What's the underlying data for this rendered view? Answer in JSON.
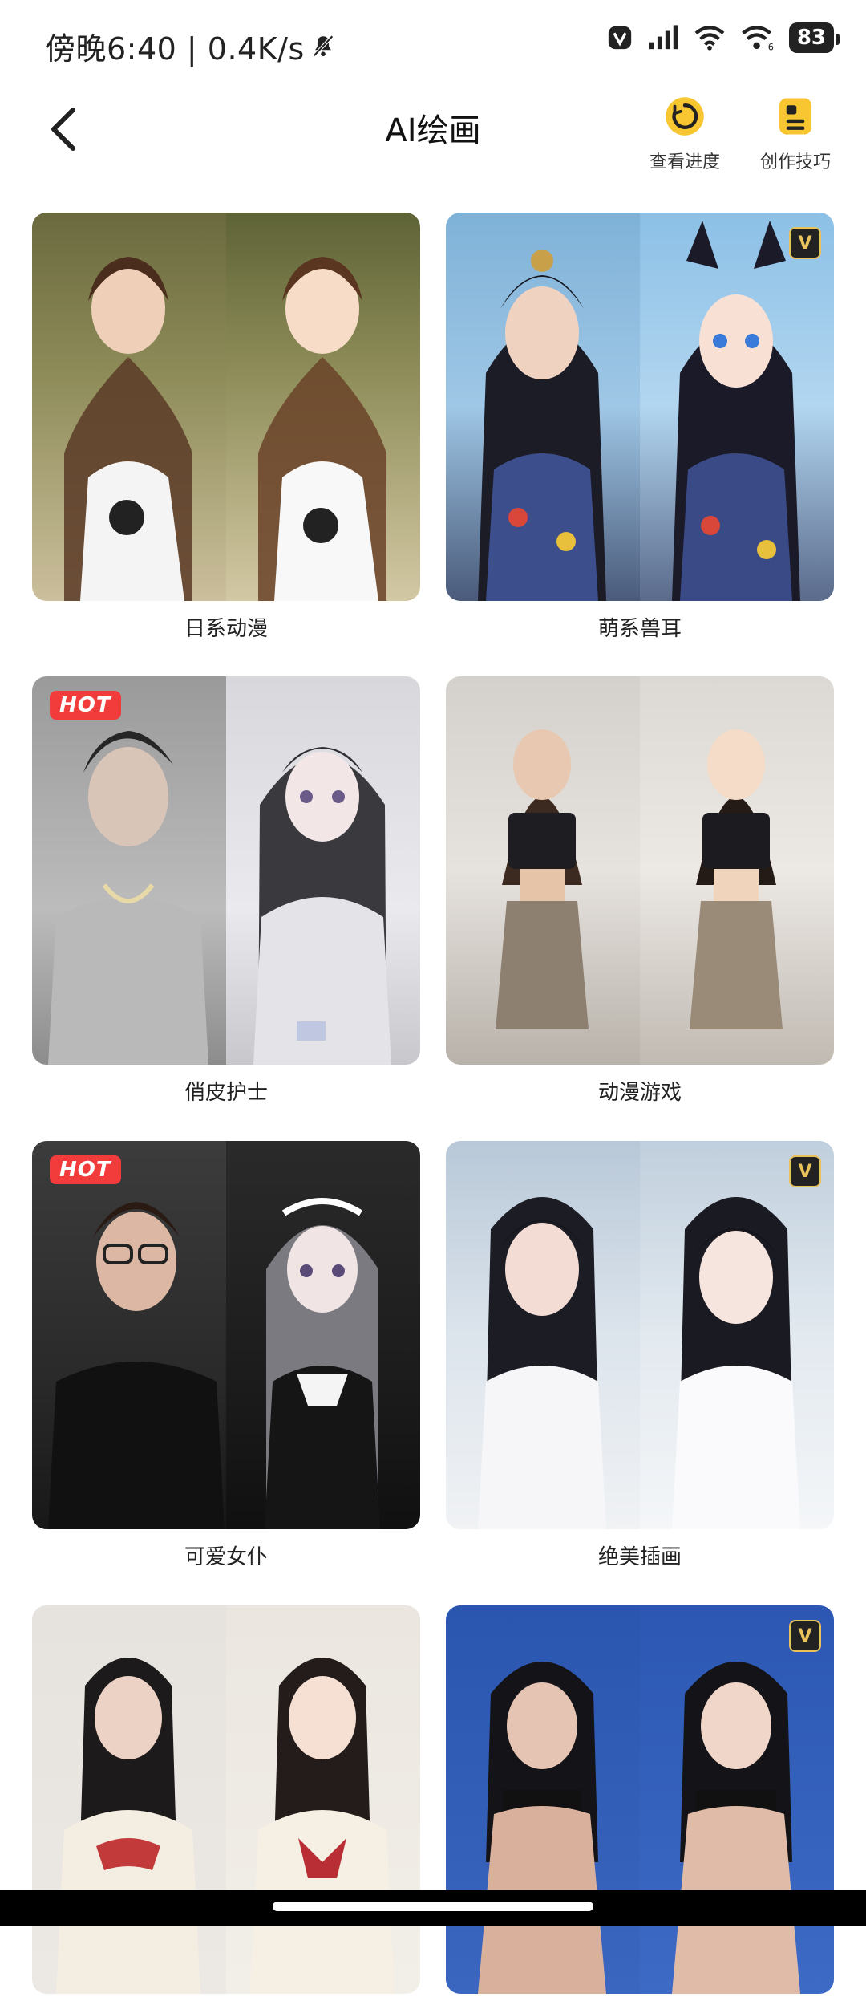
{
  "status_bar": {
    "time_text": "傍晚6:40 | 0.4K/s",
    "battery": "83"
  },
  "header": {
    "title": "AI绘画",
    "actions": [
      {
        "label": "查看进度",
        "icon": "progress-ring-icon"
      },
      {
        "label": "创作技巧",
        "icon": "document-icon"
      }
    ]
  },
  "badges": {
    "hot": "HOT",
    "vip": "V"
  },
  "styles": [
    {
      "label": "日系动漫",
      "badge": ""
    },
    {
      "label": "萌系兽耳",
      "badge": "vip"
    },
    {
      "label": "俏皮护士",
      "badge": "hot"
    },
    {
      "label": "动漫游戏",
      "badge": ""
    },
    {
      "label": "可爱女仆",
      "badge": "hot"
    },
    {
      "label": "绝美插画",
      "badge": "vip"
    },
    {
      "label": "",
      "badge": ""
    },
    {
      "label": "",
      "badge": "vip"
    }
  ],
  "colors": {
    "accent_yellow": "#f7c631",
    "hot_red": "#f23c3c",
    "vip_gold": "#e9c25a"
  }
}
